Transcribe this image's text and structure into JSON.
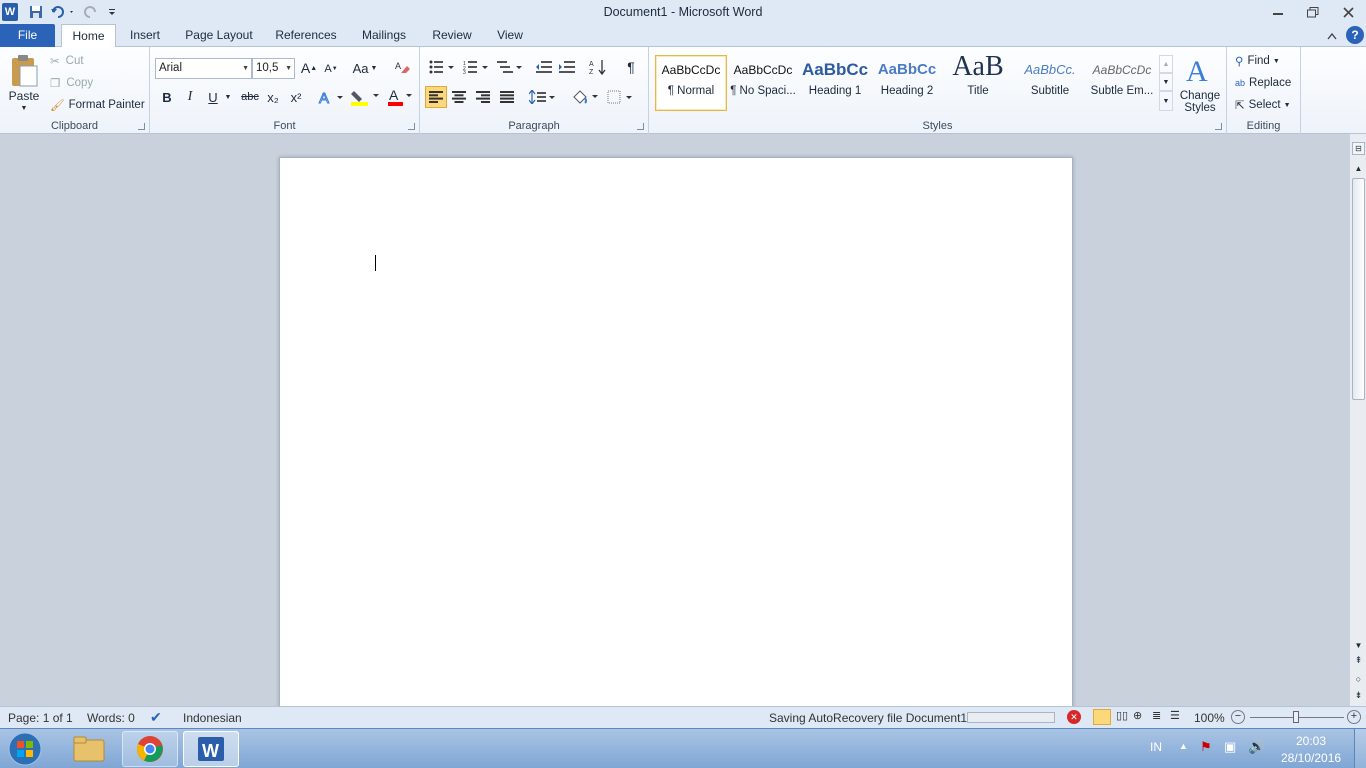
{
  "window": {
    "title": "Document1  -  Microsoft Word"
  },
  "tabs": {
    "file": "File",
    "home": "Home",
    "insert": "Insert",
    "page_layout": "Page Layout",
    "references": "References",
    "mailings": "Mailings",
    "review": "Review",
    "view": "View"
  },
  "clipboard": {
    "paste": "Paste",
    "cut": "Cut",
    "copy": "Copy",
    "format_painter": "Format Painter",
    "label": "Clipboard"
  },
  "font": {
    "name": "Arial",
    "size": "10,5",
    "label": "Font",
    "case_label": "Aa"
  },
  "font_buttons": {
    "bold": "B",
    "italic": "I",
    "underline": "U",
    "strike": "abc",
    "subscript": "x₂",
    "superscript": "x²",
    "color": "A"
  },
  "paragraph": {
    "label": "Paragraph"
  },
  "styles": {
    "label": "Styles",
    "items": [
      {
        "preview": "AaBbCcDc",
        "name": "¶ Normal"
      },
      {
        "preview": "AaBbCcDc",
        "name": "¶ No Spaci..."
      },
      {
        "preview": "AaBbCc",
        "name": "Heading 1"
      },
      {
        "preview": "AaBbCc",
        "name": "Heading 2"
      },
      {
        "preview": "AaB",
        "name": "Title"
      },
      {
        "preview": "AaBbCc.",
        "name": "Subtitle"
      },
      {
        "preview": "AaBbCcDc",
        "name": "Subtle Em..."
      }
    ],
    "change_styles": "Change Styles"
  },
  "editing": {
    "label": "Editing",
    "find": "Find",
    "replace": "Replace",
    "select": "Select"
  },
  "status": {
    "page": "Page: 1 of 1",
    "words": "Words: 0",
    "language": "Indonesian",
    "autorecovery": "Saving AutoRecovery file Document1:",
    "zoom": "100%"
  },
  "taskbar": {
    "lang": "IN",
    "time": "20:03",
    "date": "28/10/2016"
  },
  "colors": {
    "accent": "#2a63b8",
    "ribbon": "#dfe9f5",
    "highlight_bar": "#ffff00",
    "font_color_bar": "#ff0000"
  }
}
